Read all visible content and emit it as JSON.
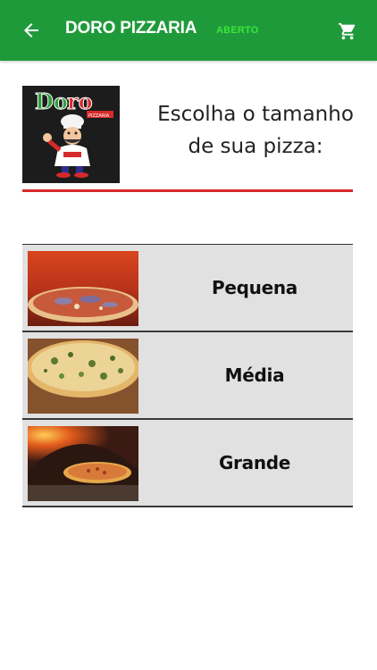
{
  "appbar": {
    "back_icon": "arrow-left-icon",
    "title": "DORO PIZZARIA",
    "status": "ABERTO",
    "status_color": "#39e639",
    "cart_icon": "cart-icon",
    "background": "#1f9a3b"
  },
  "logo": {
    "text": "Doro",
    "subtext": "PIZZARIA"
  },
  "heading": {
    "line1": "Escolha o tamanho",
    "line2": "de sua pizza:"
  },
  "accent_color": "#d62a2a",
  "sizes": [
    {
      "label": "Pequena",
      "image": "pizza-small-photo"
    },
    {
      "label": "Média",
      "image": "pizza-medium-photo"
    },
    {
      "label": "Grande",
      "image": "pizza-large-oven-photo"
    }
  ]
}
